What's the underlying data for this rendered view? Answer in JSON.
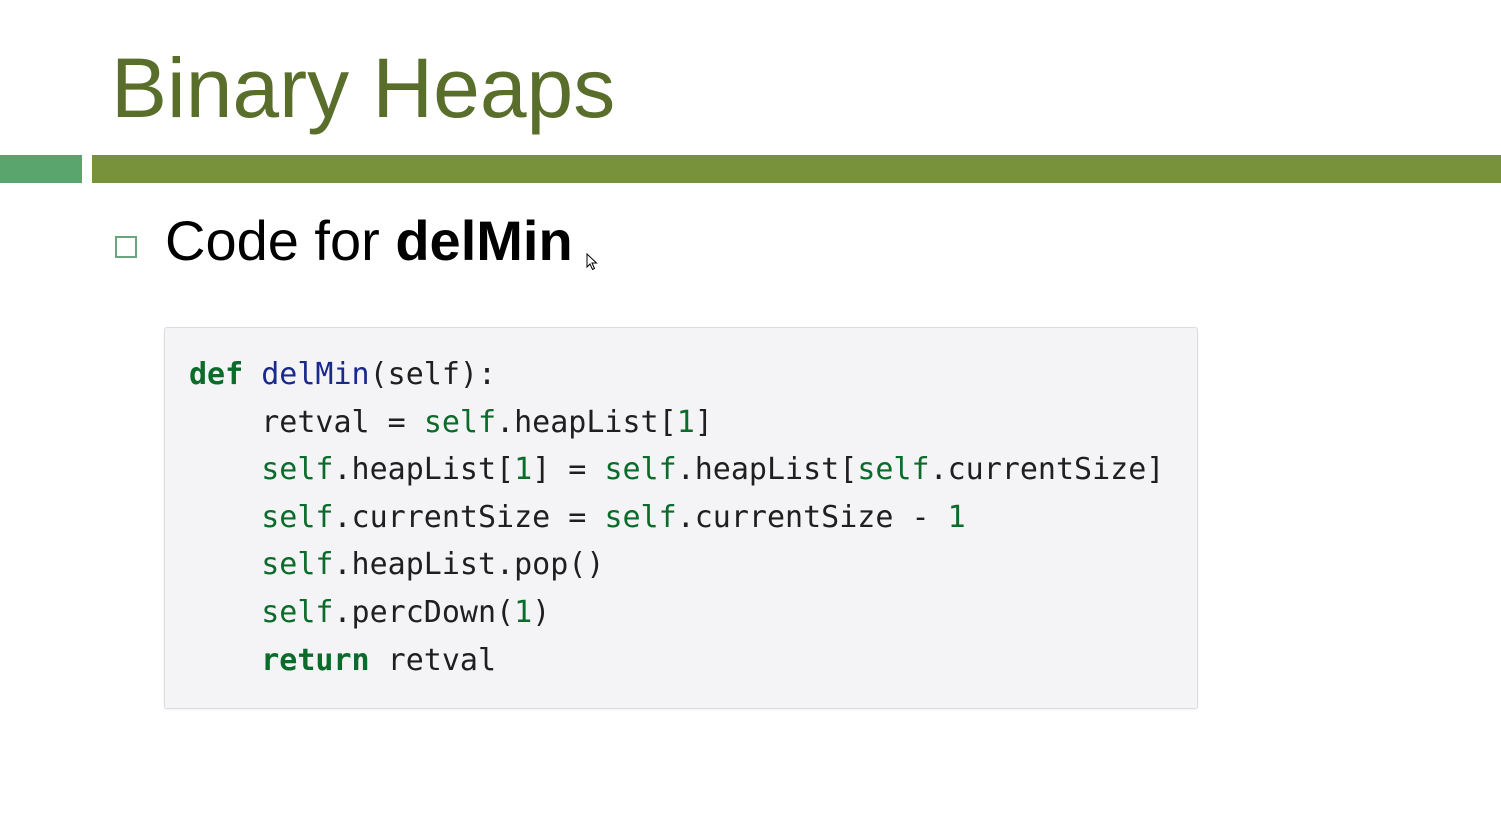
{
  "slide": {
    "title": "Binary Heaps",
    "bullet": {
      "prefix": "Code for ",
      "emphasis": "delMin"
    }
  },
  "code": {
    "language": "python",
    "lines": [
      [
        {
          "t": "def",
          "k": "kw"
        },
        {
          "t": " ",
          "k": "plain"
        },
        {
          "t": "delMin",
          "k": "fn"
        },
        {
          "t": "(self):",
          "k": "plain"
        }
      ],
      [
        {
          "t": "    retval = ",
          "k": "plain"
        },
        {
          "t": "self",
          "k": "self"
        },
        {
          "t": ".heapList[",
          "k": "plain"
        },
        {
          "t": "1",
          "k": "num"
        },
        {
          "t": "]",
          "k": "plain"
        }
      ],
      [
        {
          "t": "    ",
          "k": "plain"
        },
        {
          "t": "self",
          "k": "self"
        },
        {
          "t": ".heapList[",
          "k": "plain"
        },
        {
          "t": "1",
          "k": "num"
        },
        {
          "t": "] = ",
          "k": "plain"
        },
        {
          "t": "self",
          "k": "self"
        },
        {
          "t": ".heapList[",
          "k": "plain"
        },
        {
          "t": "self",
          "k": "self"
        },
        {
          "t": ".currentSize]",
          "k": "plain"
        }
      ],
      [
        {
          "t": "    ",
          "k": "plain"
        },
        {
          "t": "self",
          "k": "self"
        },
        {
          "t": ".currentSize = ",
          "k": "plain"
        },
        {
          "t": "self",
          "k": "self"
        },
        {
          "t": ".currentSize - ",
          "k": "plain"
        },
        {
          "t": "1",
          "k": "num"
        }
      ],
      [
        {
          "t": "    ",
          "k": "plain"
        },
        {
          "t": "self",
          "k": "self"
        },
        {
          "t": ".heapList.pop()",
          "k": "plain"
        }
      ],
      [
        {
          "t": "    ",
          "k": "plain"
        },
        {
          "t": "self",
          "k": "self"
        },
        {
          "t": ".percDown(",
          "k": "plain"
        },
        {
          "t": "1",
          "k": "num"
        },
        {
          "t": ")",
          "k": "plain"
        }
      ],
      [
        {
          "t": "    ",
          "k": "plain"
        },
        {
          "t": "return",
          "k": "kw"
        },
        {
          "t": " retval",
          "k": "plain"
        }
      ]
    ]
  },
  "colors": {
    "title": "#5a6e2b",
    "rule_left": "#5aa56e",
    "rule_right": "#77923b",
    "bullet_box": "#6aa57e",
    "code_background": "#f4f3f6",
    "keyword": "#0b6b2a",
    "function_name": "#1a2a8c"
  },
  "icons": {
    "bullet": "hollow-square-bullet-icon",
    "cursor": "mouse-pointer-icon"
  }
}
